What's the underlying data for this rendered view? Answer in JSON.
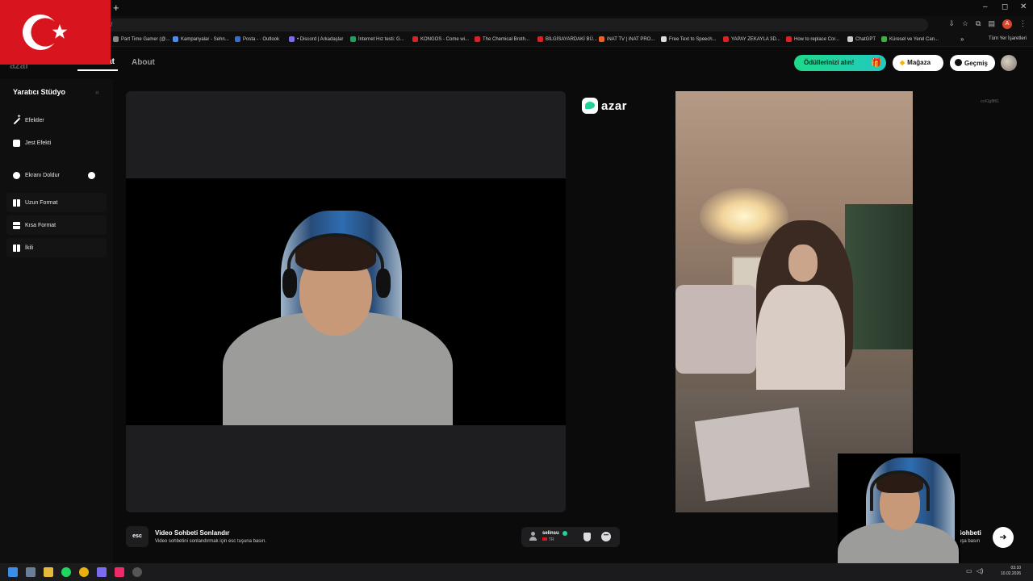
{
  "browser": {
    "new_tab_label": "+",
    "url": "ttr/",
    "window_controls": [
      "–",
      "◻",
      "✕"
    ],
    "profile_initial": "A",
    "bookmarks": [
      {
        "label": "Part Time Gamer (@...",
        "color": "#888888"
      },
      {
        "label": "Kampanyalar - Sehn...",
        "color": "#4a8ef0"
      },
      {
        "label": "Posta - · Outlook",
        "color": "#2f6fd6"
      },
      {
        "label": "• Discord | Arkadaşlar",
        "color": "#7a6cf0"
      },
      {
        "label": "İnternet Hız testi: G...",
        "color": "#20a060"
      },
      {
        "label": "KONGOS - Come wi...",
        "color": "#e02020"
      },
      {
        "label": "The Chemical Broth...",
        "color": "#e02020"
      },
      {
        "label": "BİLGİSAYARDAKİ BÜ...",
        "color": "#e02020"
      },
      {
        "label": "iNAT TV | iNAT PRO...",
        "color": "#f06020"
      },
      {
        "label": "Free Text to Speech...",
        "color": "#dddddd"
      },
      {
        "label": "YAPAY ZEKAYLA 3D...",
        "color": "#e02020"
      },
      {
        "label": "How to replace Cor...",
        "color": "#e02020"
      },
      {
        "label": "ChatGPT",
        "color": "#cccccc"
      },
      {
        "label": "Küresel ve Yerel Can...",
        "color": "#40b040"
      }
    ],
    "bookmarks_more": "»",
    "all_bookmarks_label": "Tüm Yer İşaretleri"
  },
  "header": {
    "logo_text": "azar",
    "nav_live": "Live Chat",
    "nav_about": "About",
    "rewards_label": "Ödüllerinizi alın!",
    "store_label": "Mağaza",
    "history_label": "Geçmiş"
  },
  "sidebar": {
    "title": "Yaratıcı Stüdyo",
    "collapse": "«",
    "items": [
      {
        "label": "Efektler"
      },
      {
        "label": "Jest Efekti"
      },
      {
        "label": "Ekranı Doldur"
      },
      {
        "label": "Uzun Format"
      },
      {
        "label": "Kısa Format"
      },
      {
        "label": "İkili"
      }
    ]
  },
  "main": {
    "brand": "azar",
    "session_id": "cc41g8f61",
    "end_chat": {
      "key": "esc",
      "title": "Video Sohbeti Sonlandır",
      "subtitle": "Video sohbetini sonlandırmak için esc tuşuna basın."
    },
    "peer": {
      "name": "selinsu",
      "country": "TR"
    },
    "next_chat": {
      "title": "eo Sohbeti",
      "subtitle": "sağ tuşa basın",
      "icon": "➜"
    }
  },
  "taskbar": {
    "time": "03:10",
    "date": "10.02.2026"
  },
  "colors": {
    "accent_green": "#20d39a",
    "flag_red": "#d8141f"
  }
}
